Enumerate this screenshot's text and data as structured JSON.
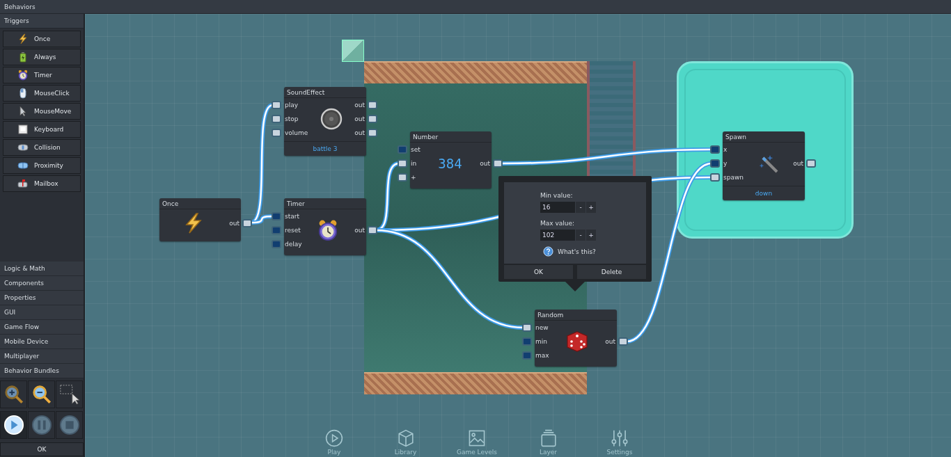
{
  "header": {
    "title": "Behaviors"
  },
  "sidebar": {
    "section": "Triggers",
    "triggers": [
      {
        "label": "Once"
      },
      {
        "label": "Always"
      },
      {
        "label": "Timer"
      },
      {
        "label": "MouseClick"
      },
      {
        "label": "MouseMove"
      },
      {
        "label": "Keyboard"
      },
      {
        "label": "Collision"
      },
      {
        "label": "Proximity"
      },
      {
        "label": "Mailbox"
      }
    ],
    "categories": [
      "Logic & Math",
      "Components",
      "Properties",
      "GUI",
      "Game Flow",
      "Mobile Device",
      "Multiplayer",
      "Behavior Bundles"
    ],
    "playback": [
      {
        "selected": true
      },
      {
        "selected": false
      },
      {
        "selected": false
      }
    ],
    "ok": "OK"
  },
  "nodes": [
    {
      "title": "Once",
      "outputs": [
        {
          "label": "out",
          "kind": "signal"
        }
      ]
    },
    {
      "title": "SoundEffect",
      "inputs": [
        {
          "label": "play",
          "kind": "signal"
        },
        {
          "label": "stop",
          "kind": "signal"
        },
        {
          "label": "volume",
          "kind": "signal"
        }
      ],
      "outputs": [
        {
          "label": "out",
          "kind": "signal"
        },
        {
          "label": "out",
          "kind": "signal"
        },
        {
          "label": "out",
          "kind": "signal"
        }
      ],
      "footer": "battle 3"
    },
    {
      "title": "Timer",
      "inputs": [
        {
          "label": "start",
          "kind": "data"
        },
        {
          "label": "reset",
          "kind": "data"
        },
        {
          "label": "delay",
          "kind": "data"
        }
      ],
      "outputs": [
        {
          "label": "out",
          "kind": "signal"
        }
      ]
    },
    {
      "title": "Number",
      "value": "384",
      "inputs": [
        {
          "label": "set",
          "kind": "data"
        },
        {
          "label": "in",
          "kind": "signal"
        },
        {
          "label": "+",
          "kind": "signal"
        }
      ],
      "outputs": [
        {
          "label": "out",
          "kind": "signal"
        }
      ]
    },
    {
      "title": "Random",
      "inputs": [
        {
          "label": "new",
          "kind": "signal"
        },
        {
          "label": "min",
          "kind": "data"
        },
        {
          "label": "max",
          "kind": "data"
        }
      ],
      "outputs": [
        {
          "label": "out",
          "kind": "signal"
        }
      ]
    },
    {
      "title": "Spawn",
      "inputs": [
        {
          "label": "x",
          "kind": "data"
        },
        {
          "label": "y",
          "kind": "data"
        },
        {
          "label": "spawn",
          "kind": "signal"
        }
      ],
      "outputs": [
        {
          "label": "out",
          "kind": "signal"
        }
      ],
      "footer": "down"
    }
  ],
  "popup": {
    "fields": [
      {
        "label": "Min value:",
        "value": "16",
        "decrement": "-",
        "increment": "+"
      },
      {
        "label": "Max value:",
        "value": "102",
        "decrement": "-",
        "increment": "+"
      }
    ],
    "help": "What's this?",
    "ok": "OK",
    "delete": "Delete"
  },
  "dock": [
    {
      "label": "Play"
    },
    {
      "label": "Library"
    },
    {
      "label": "Game Levels"
    },
    {
      "label": "Layer"
    },
    {
      "label": "Settings"
    }
  ]
}
